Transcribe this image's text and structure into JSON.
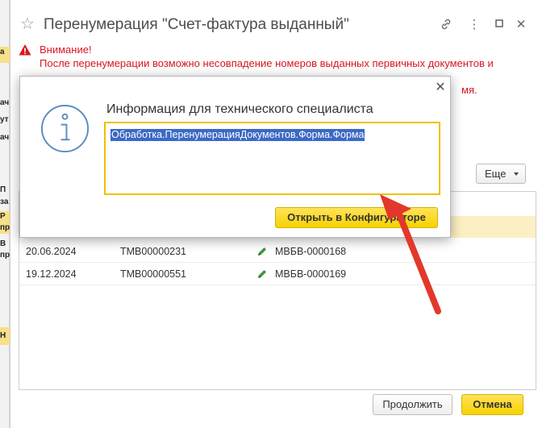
{
  "window": {
    "title": "Перенумерация \"Счет-фактура выданный\""
  },
  "warning": {
    "heading": "Внимание!",
    "line1": "После перенумерации возможно несовпадение номеров выданных первичных документов и",
    "line2_visible_tail": "мя."
  },
  "toolbar": {
    "more_label": "Еще"
  },
  "table": {
    "rows": [
      {
        "date": "20.06.2024",
        "number": "ТМВ00000231",
        "new_number": "МВБВ-0000168"
      },
      {
        "date": "19.12.2024",
        "number": "ТМВ00000551",
        "new_number": "МВБВ-0000169"
      }
    ]
  },
  "footer": {
    "continue_label": "Продолжить",
    "cancel_label": "Отмена"
  },
  "dialog": {
    "title": "Информация для технического специалиста",
    "field_value": "Обработка.ПеренумерацияДокументов.Форма.Форма",
    "open_button_label": "Открыть в Конфигураторе"
  },
  "background": {
    "fragments": [
      "а",
      "ач",
      "ут",
      "ач",
      "П",
      "за",
      "Р",
      "пр",
      "В",
      "пр",
      "Н"
    ]
  },
  "colors": {
    "warning_text": "#d9161f",
    "accent_yellow": "#f7d200",
    "selection_blue": "#3b69c6",
    "arrow_red": "#e2382b",
    "row_highlight": "#fcefc4"
  },
  "icons": {
    "favorite": "star-icon",
    "link": "link-icon",
    "menu": "more-vertical-icon",
    "maximize": "maximize-icon",
    "close": "close-icon",
    "warning": "warning-icon",
    "info": "info-icon",
    "edit": "pencil-icon"
  }
}
